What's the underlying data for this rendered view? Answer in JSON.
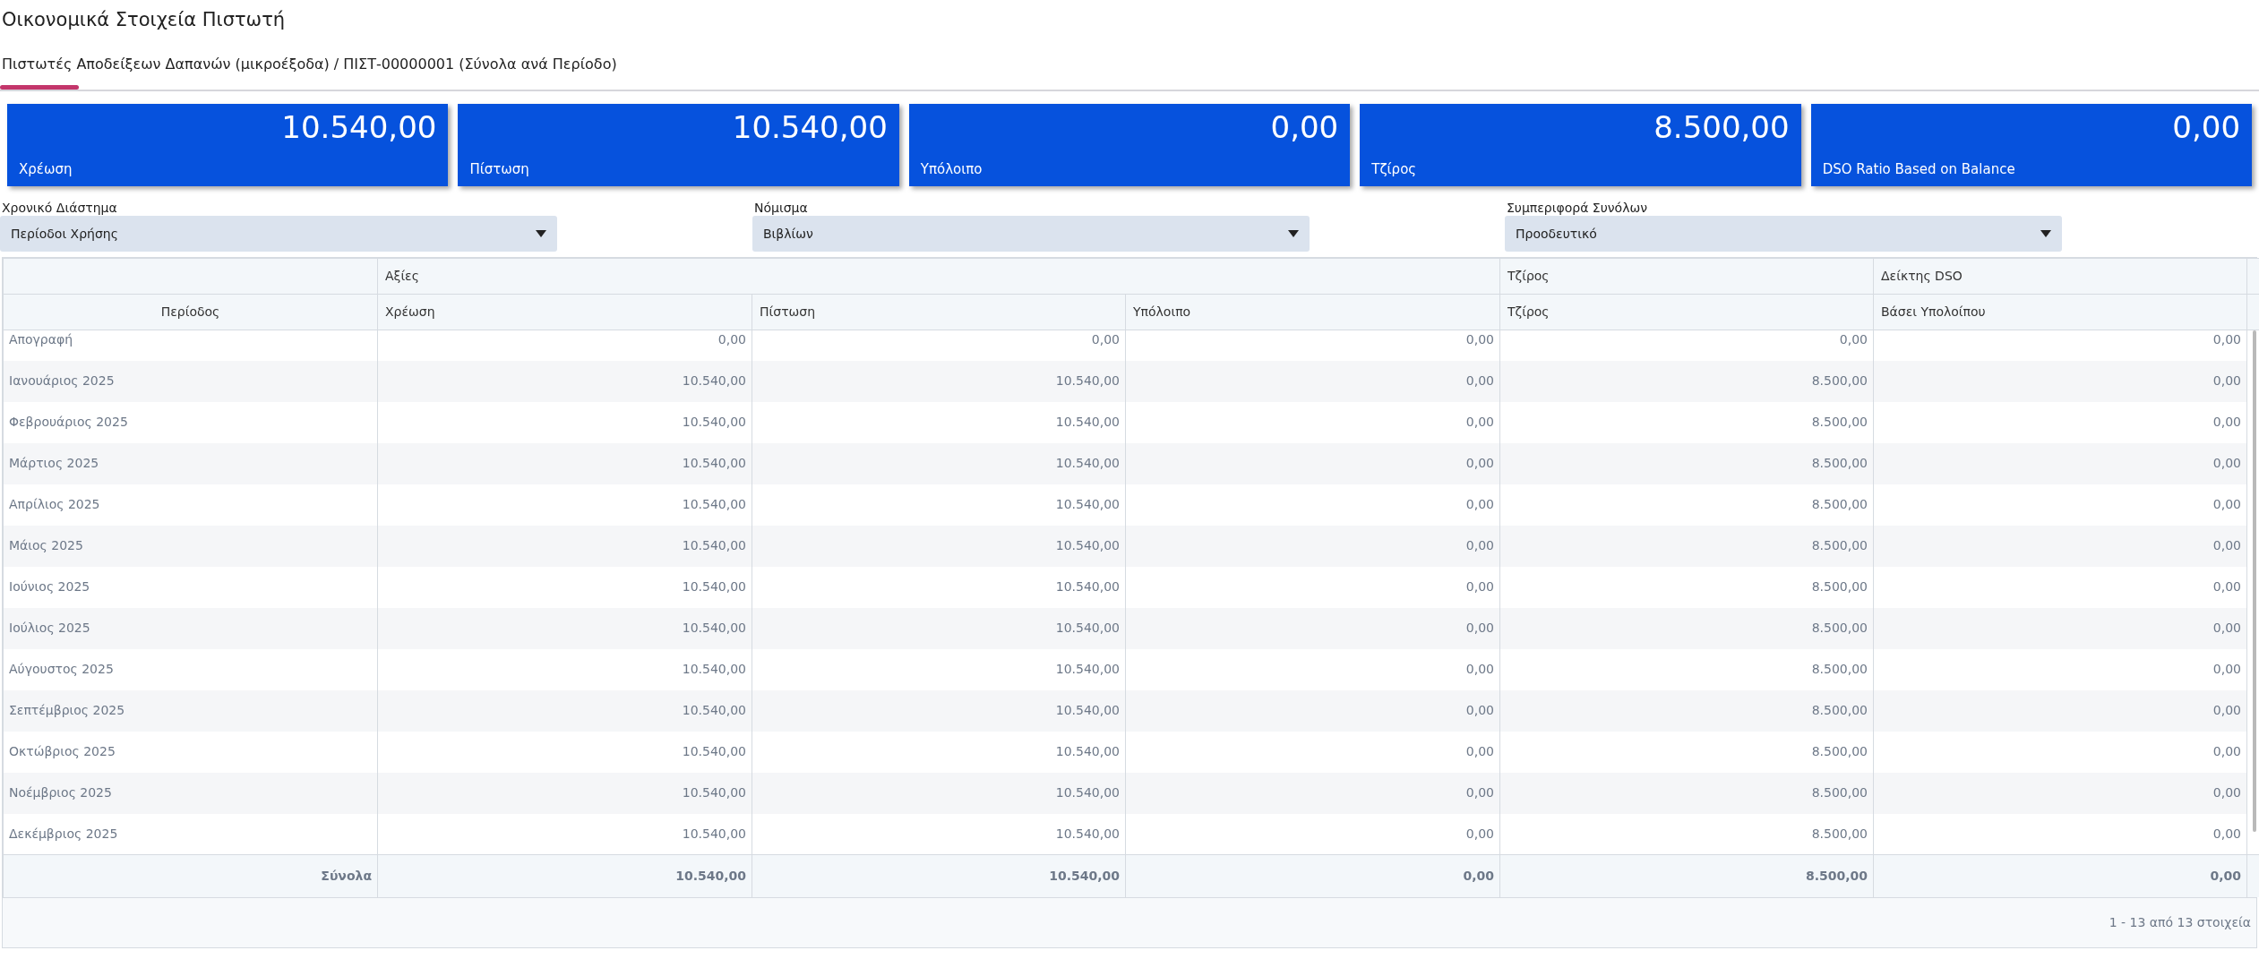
{
  "page_title": "Οικονομικά Στοιχεία Πιστωτή",
  "tabs": [
    {
      "label": "Πιστωτές Αποδείξεων Δαπανών (μικροέξοδα) / ΠΙΣΤ-00000001 (Σύνολα ανά Περίοδο)",
      "selected": true
    }
  ],
  "cards": [
    {
      "value": "10.540,00",
      "label": "Χρέωση"
    },
    {
      "value": "10.540,00",
      "label": "Πίστωση"
    },
    {
      "value": "0,00",
      "label": "Υπόλοιπο"
    },
    {
      "value": "8.500,00",
      "label": "Τζίρος"
    },
    {
      "value": "0,00",
      "label": "DSO Ratio Based on Balance"
    }
  ],
  "filters": [
    {
      "label": "Χρονικό Διάστημα",
      "value": "Περίοδοι Χρήσης"
    },
    {
      "label": "Νόμισμα",
      "value": "Βιβλίων"
    },
    {
      "label": "Συμπεριφορά Συνόλων",
      "value": "Προοδευτικό"
    }
  ],
  "table": {
    "first_column": "Περίοδος",
    "column_groups": [
      {
        "label": "Αξίες",
        "columns": [
          "Χρέωση",
          "Πίστωση",
          "Υπόλοιπο"
        ]
      },
      {
        "label": "Τζίρος",
        "columns": [
          "Τζίρος"
        ]
      },
      {
        "label": "Δείκτης DSO",
        "columns": [
          "Βάσει Υπολοίπου"
        ]
      }
    ],
    "rows": [
      {
        "period": "Απογραφή",
        "values": [
          "0,00",
          "0,00",
          "0,00",
          "0,00",
          "0,00"
        ]
      },
      {
        "period": "Ιανουάριος 2025",
        "values": [
          "10.540,00",
          "10.540,00",
          "0,00",
          "8.500,00",
          "0,00"
        ]
      },
      {
        "period": "Φεβρουάριος 2025",
        "values": [
          "10.540,00",
          "10.540,00",
          "0,00",
          "8.500,00",
          "0,00"
        ]
      },
      {
        "period": "Μάρτιος 2025",
        "values": [
          "10.540,00",
          "10.540,00",
          "0,00",
          "8.500,00",
          "0,00"
        ]
      },
      {
        "period": "Απρίλιος 2025",
        "values": [
          "10.540,00",
          "10.540,00",
          "0,00",
          "8.500,00",
          "0,00"
        ]
      },
      {
        "period": "Μάιος 2025",
        "values": [
          "10.540,00",
          "10.540,00",
          "0,00",
          "8.500,00",
          "0,00"
        ]
      },
      {
        "period": "Ιούνιος 2025",
        "values": [
          "10.540,00",
          "10.540,00",
          "0,00",
          "8.500,00",
          "0,00"
        ]
      },
      {
        "period": "Ιούλιος 2025",
        "values": [
          "10.540,00",
          "10.540,00",
          "0,00",
          "8.500,00",
          "0,00"
        ]
      },
      {
        "period": "Αύγουστος 2025",
        "values": [
          "10.540,00",
          "10.540,00",
          "0,00",
          "8.500,00",
          "0,00"
        ]
      },
      {
        "period": "Σεπτέμβριος 2025",
        "values": [
          "10.540,00",
          "10.540,00",
          "0,00",
          "8.500,00",
          "0,00"
        ]
      },
      {
        "period": "Οκτώβριος 2025",
        "values": [
          "10.540,00",
          "10.540,00",
          "0,00",
          "8.500,00",
          "0,00"
        ]
      },
      {
        "period": "Νοέμβριος 2025",
        "values": [
          "10.540,00",
          "10.540,00",
          "0,00",
          "8.500,00",
          "0,00"
        ]
      },
      {
        "period": "Δεκέμβριος 2025",
        "values": [
          "10.540,00",
          "10.540,00",
          "0,00",
          "8.500,00",
          "0,00"
        ]
      }
    ],
    "totals": {
      "label": "Σύνολα",
      "values": [
        "10.540,00",
        "10.540,00",
        "0,00",
        "8.500,00",
        "0,00"
      ]
    }
  },
  "pager": "1 - 13 από 13 στοιχεία"
}
